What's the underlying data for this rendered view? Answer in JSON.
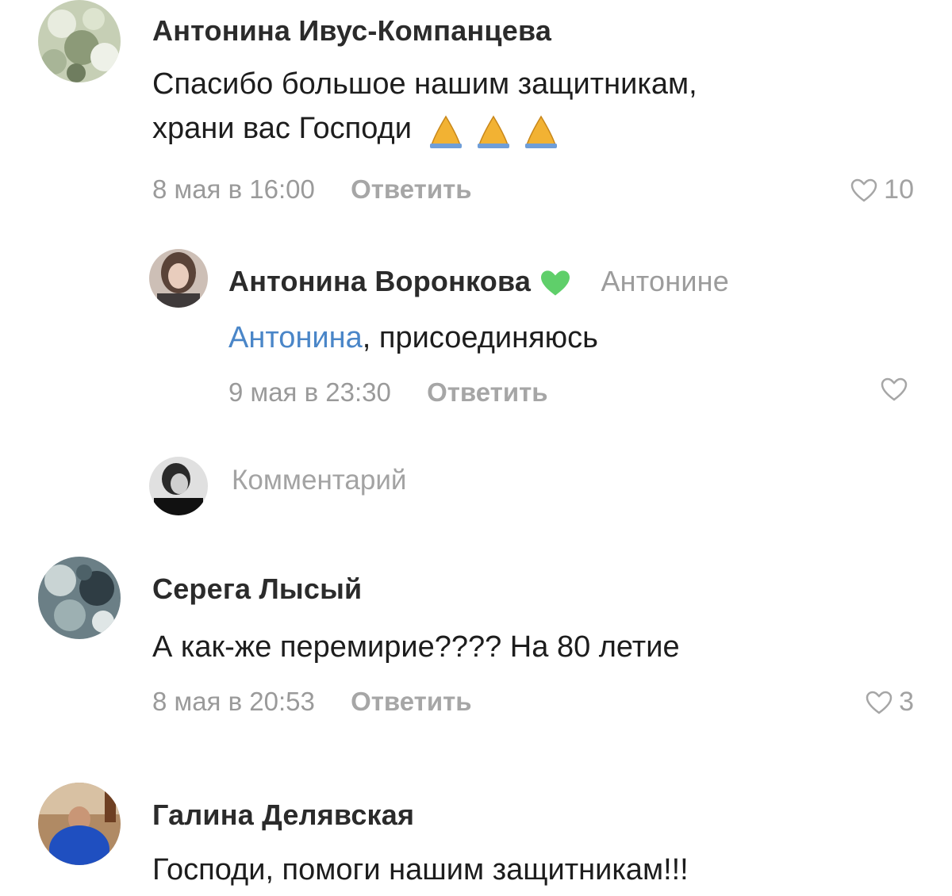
{
  "comments": [
    {
      "author": "Антонина Ивус-Компанцева",
      "text_line1": "Спасибо большое нашим защитникам,",
      "text_line2": "храни вас Господи",
      "emoji": "praying-hands-icon x3",
      "date": "8 мая в 16:00",
      "reply_label": "Ответить",
      "likes": "10"
    },
    {
      "author": "Антонина Воронкова",
      "author_badge": "green-heart-icon",
      "addressee": "Антонине",
      "mention": "Антонина",
      "text": ", присоединяюсь",
      "date": "9 мая в 23:30",
      "reply_label": "Ответить",
      "likes": ""
    },
    {
      "author": "Серега Лысый",
      "text": "А как-же перемирие???? На 80 летие",
      "date": "8 мая в 20:53",
      "reply_label": "Ответить",
      "likes": "3"
    },
    {
      "author": "Галина Делявская",
      "text": "Господи, помоги нашим защитникам!!!"
    }
  ],
  "comment_input": {
    "placeholder": "Комментарий"
  },
  "colors": {
    "mention": "#4a86c8",
    "green_heart": "#5fcf6a",
    "meta_text": "#9a9a9a"
  }
}
